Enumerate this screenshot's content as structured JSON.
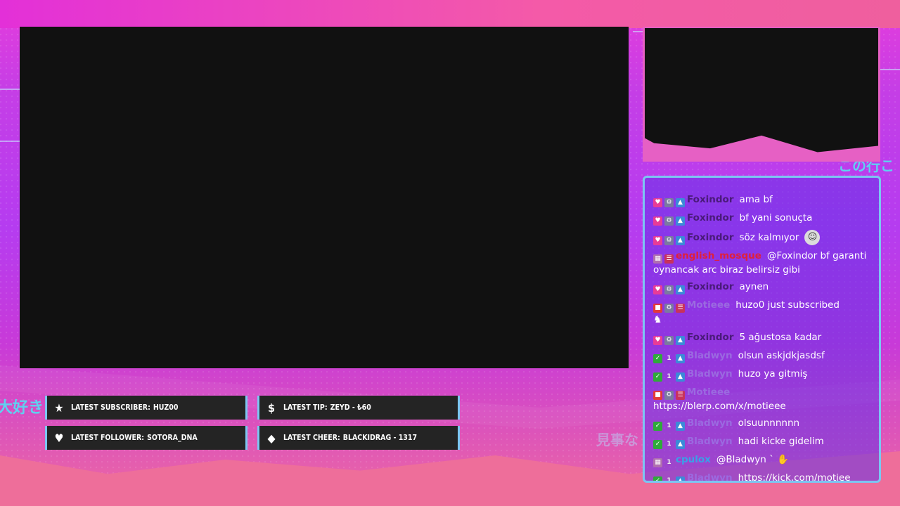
{
  "overlay": {
    "japanese_left": "大好き",
    "japanese_right_top": "この行こ",
    "japanese_right_bottom": "見事な"
  },
  "stats": {
    "latest_subscriber_label": "LATEST SUBSCRIBER:",
    "latest_subscriber_value": "HUZ00",
    "latest_tip_label": "LATEST TIP:",
    "latest_tip_value": "ZEYD - ₺60",
    "latest_follower_label": "LATEST FOLLOWER:",
    "latest_follower_value": "SOTORA_DNA",
    "latest_cheer_label": "LATEST CHEER:",
    "latest_cheer_value": "BLACKIDRAG - 1317"
  },
  "chat": {
    "messages": [
      {
        "user": "Foxindor",
        "color": "#4a1a7a",
        "text": "ama bf",
        "badges": [
          "heart",
          "mod",
          "rank"
        ]
      },
      {
        "user": "Foxindor",
        "color": "#4a1a7a",
        "text": "bf yani sonuçta",
        "badges": [
          "heart",
          "mod",
          "rank"
        ]
      },
      {
        "user": "Foxindor",
        "color": "#4a1a7a",
        "text": "söz kalmıyor",
        "badges": [
          "heart",
          "mod",
          "rank"
        ],
        "emote": "face-emote"
      },
      {
        "user": "english_mosque",
        "color": "#e0203a",
        "text": "@Foxindor bf garanti oynancak arc biraz belirsiz gibi",
        "badges": [
          "gift",
          "red"
        ]
      },
      {
        "user": "Foxindor",
        "color": "#4a1a7a",
        "text": "aynen",
        "badges": [
          "heart",
          "mod",
          "rank"
        ]
      },
      {
        "user": "Motieee",
        "color": "#9b6ae0",
        "text": "huzo0 just subscribed",
        "badges": [
          "cam",
          "mod",
          "red"
        ],
        "emote2": "dance-emote"
      },
      {
        "user": "Foxindor",
        "color": "#4a1a7a",
        "text": "5 ağustosa kadar",
        "badges": [
          "heart",
          "mod",
          "rank"
        ]
      },
      {
        "user": "Bladwyn",
        "color": "#9b6ae0",
        "text": "olsun askjdkjasdsf",
        "badges": [
          "check",
          "one",
          "rank"
        ]
      },
      {
        "user": "Bladwyn",
        "color": "#9b6ae0",
        "text": "huzo ya gitmiş",
        "badges": [
          "check",
          "one",
          "rank"
        ]
      },
      {
        "user": "Motieee",
        "color": "#9b6ae0",
        "text": "https://blerp.com/x/motieee",
        "badges": [
          "cam",
          "mod",
          "red"
        ],
        "wrap": true
      },
      {
        "user": "Bladwyn",
        "color": "#9b6ae0",
        "text": "olsuunnnnnn",
        "badges": [
          "check",
          "one",
          "rank"
        ]
      },
      {
        "user": "Bladwyn",
        "color": "#9b6ae0",
        "text": "hadi kicke gidelim",
        "badges": [
          "check",
          "one",
          "rank"
        ]
      },
      {
        "user": "cpulox",
        "color": "#3aa0e8",
        "text": "@Bladwyn ` ✋",
        "badges": [
          "gift",
          "one"
        ]
      },
      {
        "user": "Bladwyn",
        "color": "#9b6ae0",
        "text": "https://kick.com/motiee",
        "badges": [
          "check",
          "one",
          "rank"
        ]
      }
    ]
  },
  "colors": {
    "accent_cyan": "#7cc6f2",
    "bg_magenta": "#c53ee6",
    "panel_dark": "#242424"
  }
}
